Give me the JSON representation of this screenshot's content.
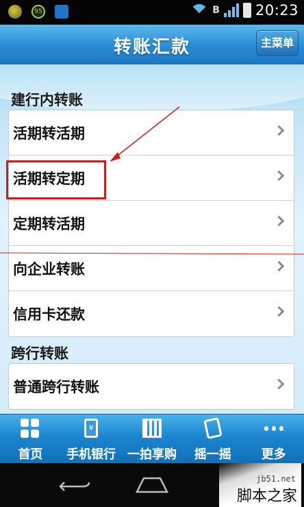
{
  "status_bar": {
    "time": "20:23",
    "notification_badge": "95",
    "network_label": "B"
  },
  "header": {
    "title": "转账汇款",
    "menu_label": "主菜单"
  },
  "sections": [
    {
      "title": "建行内转账",
      "items": [
        {
          "label": "活期转活期"
        },
        {
          "label": "活期转定期"
        },
        {
          "label": "定期转活期"
        },
        {
          "label": "向企业转账"
        },
        {
          "label": "信用卡还款"
        }
      ]
    },
    {
      "title": "跨行转账",
      "items": [
        {
          "label": "普通跨行转账"
        }
      ]
    }
  ],
  "tabs": [
    {
      "label": "首页",
      "icon": "home-grid-icon"
    },
    {
      "label": "手机银行",
      "icon": "mobile-bank-icon"
    },
    {
      "label": "一拍享购",
      "icon": "qr-code-icon"
    },
    {
      "label": "摇一摇",
      "icon": "shake-phone-icon"
    },
    {
      "label": "更多",
      "icon": "more-dots-icon"
    }
  ],
  "watermark": {
    "site": "jb51.net",
    "text": "脚本之家"
  },
  "colors": {
    "accent_blue": "#1e78c2",
    "annotation_red": "#c8201f"
  }
}
